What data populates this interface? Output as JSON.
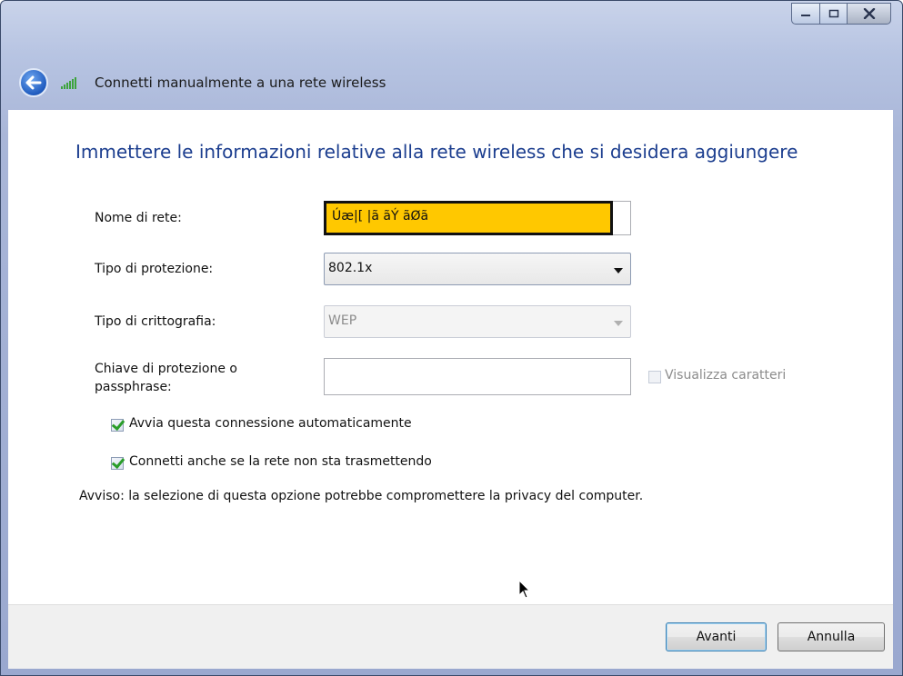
{
  "window": {
    "nav_title": "Connetti manualmente a una rete wireless"
  },
  "content": {
    "heading": "Immettere le informazioni relative alla rete wireless che si desidera aggiungere",
    "network_name": {
      "label": "Nome di rete:",
      "value": "Úæ|[ |ã ãÝ ãØã"
    },
    "security_type": {
      "label": "Tipo di protezione:",
      "value": "802.1x"
    },
    "encryption_type": {
      "label": "Tipo di crittografia:",
      "value": "WEP"
    },
    "security_key": {
      "label_line1": "Chiave di protezione o",
      "label_line2": "passphrase:",
      "value": "",
      "show_chars_label": "Visualizza caratteri"
    },
    "auto_start": {
      "label": "Avvia questa connessione automaticamente",
      "checked": true
    },
    "connect_hidden": {
      "label": "Connetti anche se la rete non sta trasmettendo",
      "checked": true
    },
    "warning": "Avviso: la selezione di questa opzione potrebbe compromettere la privacy del computer."
  },
  "footer": {
    "next_label": "Avanti",
    "cancel_label": "Annulla"
  },
  "icons": [
    "back-arrow-icon",
    "wireless-signal-icon",
    "minimize-icon",
    "maximize-icon",
    "close-icon",
    "mouse-cursor-icon"
  ]
}
